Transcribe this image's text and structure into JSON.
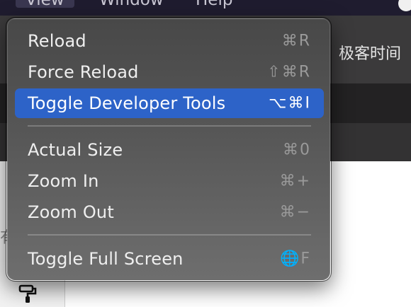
{
  "menubar": {
    "items": [
      {
        "label": "View",
        "active": true
      },
      {
        "label": "Window",
        "active": false
      },
      {
        "label": "Help",
        "active": false
      }
    ]
  },
  "app": {
    "toolbar_title": "极客时间",
    "edge_glyph": "有"
  },
  "menu": {
    "title": "View",
    "items": [
      {
        "id": "reload",
        "label": "Reload",
        "shortcut": "⌘R",
        "highlighted": false
      },
      {
        "id": "force-reload",
        "label": "Force Reload",
        "shortcut": "⇧⌘R",
        "highlighted": false
      },
      {
        "id": "toggle-developer-tools",
        "label": "Toggle Developer Tools",
        "shortcut": "⌥⌘I",
        "highlighted": true
      },
      {
        "id": "actual-size",
        "label": "Actual Size",
        "shortcut": "⌘0",
        "highlighted": false
      },
      {
        "id": "zoom-in",
        "label": "Zoom In",
        "shortcut": "⌘+",
        "highlighted": false
      },
      {
        "id": "zoom-out",
        "label": "Zoom Out",
        "shortcut": "⌘−",
        "highlighted": false
      },
      {
        "id": "toggle-full-screen",
        "label": "Toggle Full Screen",
        "shortcut": "🌐F",
        "highlighted": false
      }
    ]
  },
  "colors": {
    "highlight": "#2d63c8",
    "menu_text": "#efefef",
    "shortcut_text": "#9a9a9a"
  }
}
